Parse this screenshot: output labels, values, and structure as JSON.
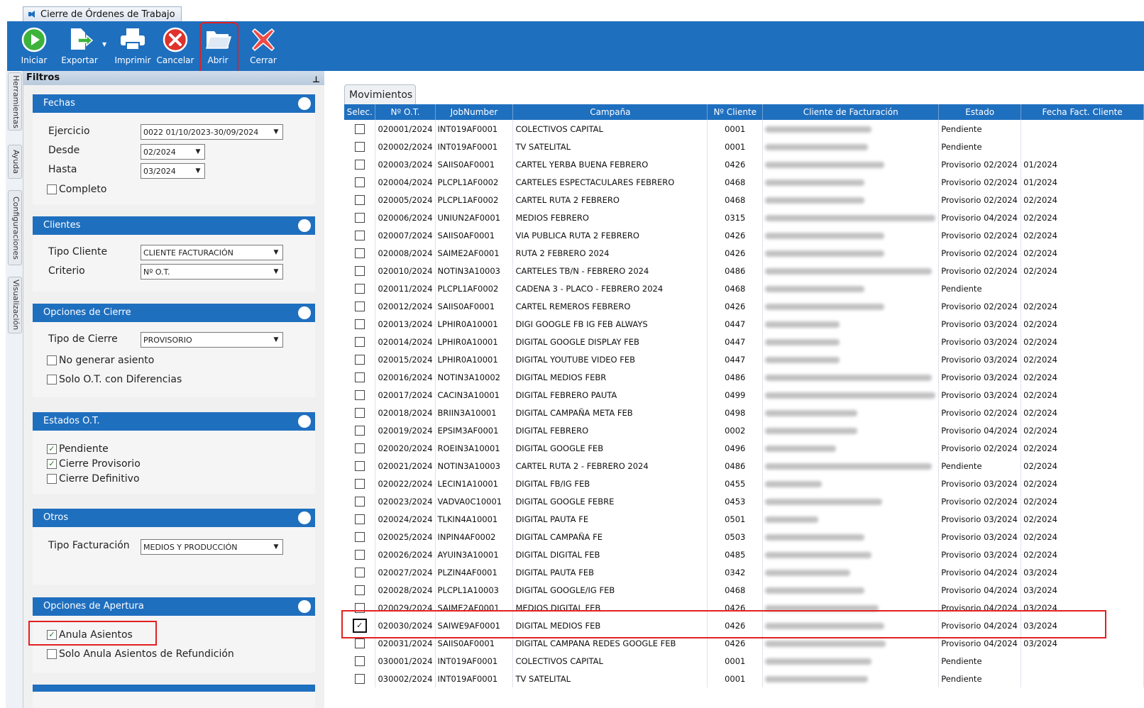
{
  "window": {
    "tab_title": "Cierre de Órdenes de Trabajo"
  },
  "toolbar": {
    "buttons": [
      {
        "label": "Iniciar",
        "icon": "play-icon",
        "color": "#3db33b"
      },
      {
        "label": "Exportar",
        "icon": "export-icon",
        "color": "#ffffff"
      },
      {
        "label": "Imprimir",
        "icon": "printer-icon",
        "color": "#ffffff"
      },
      {
        "label": "Cancelar",
        "icon": "cancel-icon",
        "color": "#e0312b"
      },
      {
        "label": "Abrir",
        "icon": "open-folder-icon",
        "color": "#ffffff"
      },
      {
        "label": "Cerrar",
        "icon": "close-icon",
        "color": "#e44"
      }
    ]
  },
  "sidetabs": [
    "Herramientas",
    "Ayuda",
    "Configuraciones",
    "Visualización"
  ],
  "filters": {
    "title": "Filtros",
    "fechas": {
      "title": "Fechas",
      "ejercicio_label": "Ejercicio",
      "ejercicio_value": "0022 01/10/2023-30/09/2024",
      "desde_label": "Desde",
      "desde_value": "02/2024",
      "hasta_label": "Hasta",
      "hasta_value": "03/2024",
      "completo_label": "Completo",
      "completo_checked": false
    },
    "clientes": {
      "title": "Clientes",
      "tipo_label": "Tipo Cliente",
      "tipo_value": "CLIENTE FACTURACIÓN",
      "criterio_label": "Criterio",
      "criterio_value": "Nº O.T."
    },
    "cierre": {
      "title": "Opciones de Cierre",
      "tipo_label": "Tipo de Cierre",
      "tipo_value": "PROVISORIO",
      "no_generar_label": "No generar asiento",
      "solo_ot_label": "Solo O.T. con Diferencias"
    },
    "estados": {
      "title": "Estados O.T.",
      "pendiente_label": "Pendiente",
      "provisorio_label": "Cierre Provisorio",
      "definitivo_label": "Cierre Definitivo"
    },
    "otros": {
      "title": "Otros",
      "tipo_fact_label": "Tipo Facturación",
      "tipo_fact_value": "MEDIOS Y PRODUCCIÓN"
    },
    "apertura": {
      "title": "Opciones de Apertura",
      "anula_label": "Anula Asientos",
      "solo_anula_label": "Solo Anula Asientos de Refundición"
    }
  },
  "movimientos": {
    "tab_label": "Movimientos",
    "columns": [
      "Selec.",
      "Nº O.T.",
      "JobNumber",
      "Campaña",
      "Nº Cliente",
      "Cliente de Facturación",
      "Estado",
      "Fecha Fact. Cliente"
    ],
    "rows": [
      {
        "ot": "020001/2024",
        "job": "INT019AF0001",
        "camp": "COLECTIVOS CAPITAL",
        "cli": "0001",
        "estado": "Pendiente",
        "fecha": "",
        "sel": false
      },
      {
        "ot": "020002/2024",
        "job": "INT019AF0001",
        "camp": "TV SATELITAL",
        "cli": "0001",
        "estado": "Pendiente",
        "fecha": "",
        "sel": false
      },
      {
        "ot": "020003/2024",
        "job": "SAIIS0AF0001",
        "camp": "CARTEL YERBA BUENA FEBRERO",
        "cli": "0426",
        "estado": "Provisorio 02/2024",
        "fecha": "01/2024",
        "sel": false
      },
      {
        "ot": "020004/2024",
        "job": "PLCPL1AF0002",
        "camp": "CARTELES ESPECTACULARES FEBRERO",
        "cli": "0468",
        "estado": "Provisorio 02/2024",
        "fecha": "01/2024",
        "sel": false
      },
      {
        "ot": "020005/2024",
        "job": "PLCPL1AF0002",
        "camp": "CARTEL RUTA 2 FEBRERO",
        "cli": "0468",
        "estado": "Provisorio 02/2024",
        "fecha": "02/2024",
        "sel": false
      },
      {
        "ot": "020006/2024",
        "job": "UNIUN2AF0001",
        "camp": "MEDIOS FEBRERO",
        "cli": "0315",
        "estado": "Provisorio 04/2024",
        "fecha": "02/2024",
        "sel": false
      },
      {
        "ot": "020007/2024",
        "job": "SAIIS0AF0001",
        "camp": "VIA PUBLICA RUTA 2 FEBRERO",
        "cli": "0426",
        "estado": "Provisorio 02/2024",
        "fecha": "02/2024",
        "sel": false
      },
      {
        "ot": "020008/2024",
        "job": "SAIME2AF0001",
        "camp": "RUTA 2 FEBRERO 2024",
        "cli": "0426",
        "estado": "Provisorio 02/2024",
        "fecha": "02/2024",
        "sel": false
      },
      {
        "ot": "020010/2024",
        "job": "NOTIN3A10003",
        "camp": "CARTELES TB/N - FEBRERO 2024",
        "cli": "0486",
        "estado": "Provisorio 02/2024",
        "fecha": "02/2024",
        "sel": false
      },
      {
        "ot": "020011/2024",
        "job": "PLCPL1AF0002",
        "camp": "CADENA 3 - PLACO - FEBRERO 2024",
        "cli": "0468",
        "estado": "Pendiente",
        "fecha": "",
        "sel": false
      },
      {
        "ot": "020012/2024",
        "job": "SAIIS0AF0001",
        "camp": "CARTEL REMEROS FEBRERO",
        "cli": "0426",
        "estado": "Provisorio 02/2024",
        "fecha": "02/2024",
        "sel": false
      },
      {
        "ot": "020013/2024",
        "job": "LPHIR0A10001",
        "camp": "DIGI GOOGLE FB IG FEB ALWAYS",
        "cli": "0447",
        "estado": "Provisorio 03/2024",
        "fecha": "02/2024",
        "sel": false
      },
      {
        "ot": "020014/2024",
        "job": "LPHIR0A10001",
        "camp": "DIGITAL GOOGLE DISPLAY FEB",
        "cli": "0447",
        "estado": "Provisorio 03/2024",
        "fecha": "02/2024",
        "sel": false
      },
      {
        "ot": "020015/2024",
        "job": "LPHIR0A10001",
        "camp": "DIGITAL YOUTUBE VIDEO FEB",
        "cli": "0447",
        "estado": "Provisorio 03/2024",
        "fecha": "02/2024",
        "sel": false
      },
      {
        "ot": "020016/2024",
        "job": "NOTIN3A10002",
        "camp": "DIGITAL MEDIOS FEBR",
        "cli": "0486",
        "estado": "Provisorio 03/2024",
        "fecha": "02/2024",
        "sel": false
      },
      {
        "ot": "020017/2024",
        "job": "CACIN3A10001",
        "camp": "DIGITAL FEBRERO PAUTA",
        "cli": "0499",
        "estado": "Provisorio 03/2024",
        "fecha": "02/2024",
        "sel": false
      },
      {
        "ot": "020018/2024",
        "job": "BRIIN3A10001",
        "camp": "DIGITAL CAMPAÑA  META FEB",
        "cli": "0498",
        "estado": "Provisorio 02/2024",
        "fecha": "02/2024",
        "sel": false
      },
      {
        "ot": "020019/2024",
        "job": "EPSIM3AF0001",
        "camp": "DIGITAL FEBRERO",
        "cli": "0002",
        "estado": "Provisorio 04/2024",
        "fecha": "02/2024",
        "sel": false
      },
      {
        "ot": "020020/2024",
        "job": "ROEIN3A10001",
        "camp": "DIGITAL  GOOGLE FEB",
        "cli": "0496",
        "estado": "Provisorio 02/2024",
        "fecha": "02/2024",
        "sel": false
      },
      {
        "ot": "020021/2024",
        "job": "NOTIN3A10003",
        "camp": "CARTEL RUTA 2 - FEBRERO 2024",
        "cli": "0486",
        "estado": "Pendiente",
        "fecha": "02/2024",
        "sel": false
      },
      {
        "ot": "020022/2024",
        "job": "LECIN1A10001",
        "camp": "DIGITAL FB/IG FEB",
        "cli": "0455",
        "estado": "Provisorio 03/2024",
        "fecha": "02/2024",
        "sel": false
      },
      {
        "ot": "020023/2024",
        "job": "VADVA0C10001",
        "camp": "DIGITAL   GOOGLE FEBRE",
        "cli": "0453",
        "estado": "Provisorio 02/2024",
        "fecha": "02/2024",
        "sel": false
      },
      {
        "ot": "020024/2024",
        "job": "TLKIN4A10001",
        "camp": "DIGITAL PAUTA FE",
        "cli": "0501",
        "estado": "Provisorio 03/2024",
        "fecha": "02/2024",
        "sel": false
      },
      {
        "ot": "020025/2024",
        "job": "INPIN4AF0002",
        "camp": "DIGITAL  CAMPAÑA FE",
        "cli": "0503",
        "estado": "Provisorio 03/2024",
        "fecha": "02/2024",
        "sel": false
      },
      {
        "ot": "020026/2024",
        "job": "AYUIN3A10001",
        "camp": "DIGITAL DIGITAL FEB",
        "cli": "0485",
        "estado": "Provisorio 03/2024",
        "fecha": "02/2024",
        "sel": false
      },
      {
        "ot": "020027/2024",
        "job": "PLZIN4AF0001",
        "camp": "DIGITAL PAUTA FEB",
        "cli": "0342",
        "estado": "Provisorio 04/2024",
        "fecha": "03/2024",
        "sel": false
      },
      {
        "ot": "020028/2024",
        "job": "PLCPL1A10003",
        "camp": "DIGITAL GOOGLE/IG FEB",
        "cli": "0468",
        "estado": "Provisorio 04/2024",
        "fecha": "03/2024",
        "sel": false
      },
      {
        "ot": "020029/2024",
        "job": "SAIME2AF0001",
        "camp": "MEDIOS DIGITAL FEB",
        "cli": "0426",
        "estado": "Provisorio 04/2024",
        "fecha": "03/2024",
        "sel": false
      },
      {
        "ot": "020030/2024",
        "job": "SAIWE9AF0001",
        "camp": "DIGITAL MEDIOS  FEB",
        "cli": "0426",
        "estado": "Provisorio 04/2024",
        "fecha": "03/2024",
        "sel": true
      },
      {
        "ot": "020031/2024",
        "job": "SAIIS0AF0001",
        "camp": "DIGITAL CAMPANA REDES GOOGLE FEB",
        "cli": "0426",
        "estado": "Provisorio 04/2024",
        "fecha": "03/2024",
        "sel": false
      },
      {
        "ot": "030001/2024",
        "job": "INT019AF0001",
        "camp": "COLECTIVOS CAPITAL",
        "cli": "0001",
        "estado": "Pendiente",
        "fecha": "",
        "sel": false
      },
      {
        "ot": "030002/2024",
        "job": "INT019AF0001",
        "camp": "TV SATELITAL",
        "cli": "0001",
        "estado": "Pendiente",
        "fecha": "",
        "sel": false
      }
    ]
  },
  "colors": {
    "accent_blue": "#1f6fbf",
    "highlight_red": "#e32020"
  }
}
